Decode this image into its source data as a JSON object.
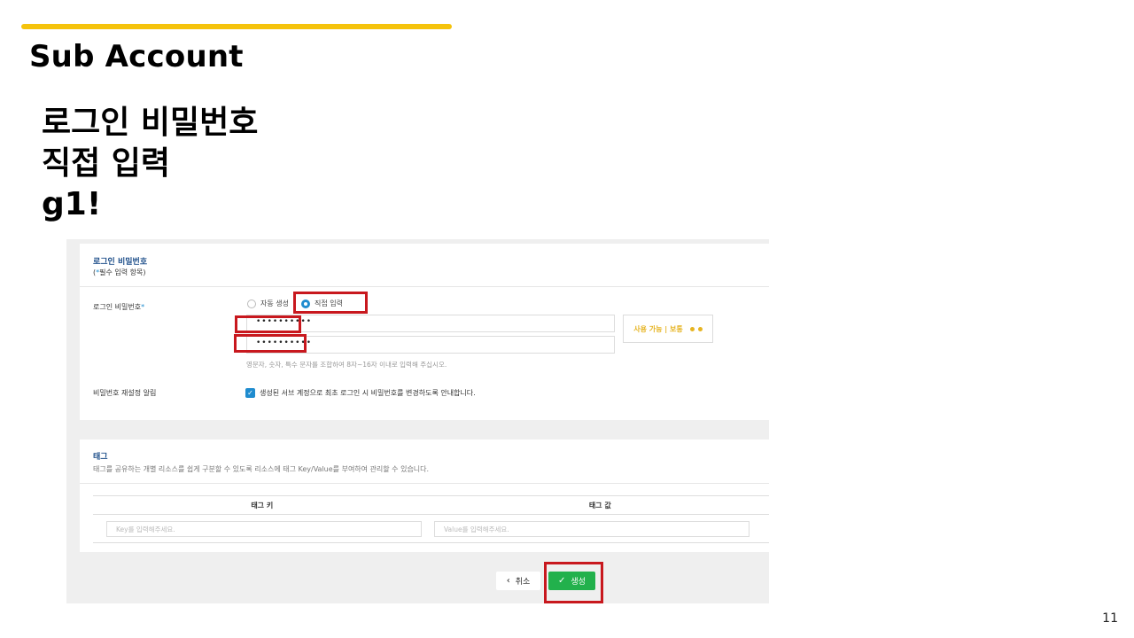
{
  "slide": {
    "title": "Sub Account",
    "lines": [
      "로그인 비밀번호",
      "직접 입력",
      "g1!"
    ],
    "page_number": "11",
    "accent_color": "#f5c30c"
  },
  "form": {
    "section_title": "로그인 비밀번호",
    "required_note_prefix": "(",
    "required_star": "*",
    "required_note_suffix": "필수 입력 항목)",
    "password_label": "로그인 비밀번호",
    "password_required": "*",
    "radio_auto": "자동 생성",
    "radio_manual": "직접 입력",
    "selected_radio": "직접 입력",
    "password_value": "••••••••••",
    "password_confirm_value": "••••••••••",
    "strength_text": "사용 가능 | 보통",
    "hint": "영문자, 숫자, 특수 문자를 조합하여 8자~16자 이내로 입력해 주십시오.",
    "reset_label": "비밀번호 재설정 알림",
    "reset_checked": true,
    "reset_text": "생성된 서브 계정으로 최초 로그인 시 비밀번호를 변경하도록 안내합니다."
  },
  "tags": {
    "title": "태그",
    "description": "태그를 공유하는 개별 리소스를 쉽게 구분할 수 있도록 리소스에 태그 Key/Value를 부여하여 관리할 수 있습니다.",
    "col_key": "태그 키",
    "col_value": "태그 값",
    "key_placeholder": "Key를 입력해주세요.",
    "value_placeholder": "Value를 입력해주세요."
  },
  "buttons": {
    "cancel": "취소",
    "create": "생성"
  },
  "colors": {
    "highlight": "#c8181e",
    "primary_blue": "#1f8ccf",
    "create_green": "#22b14c",
    "strength_yellow": "#e6b422"
  }
}
